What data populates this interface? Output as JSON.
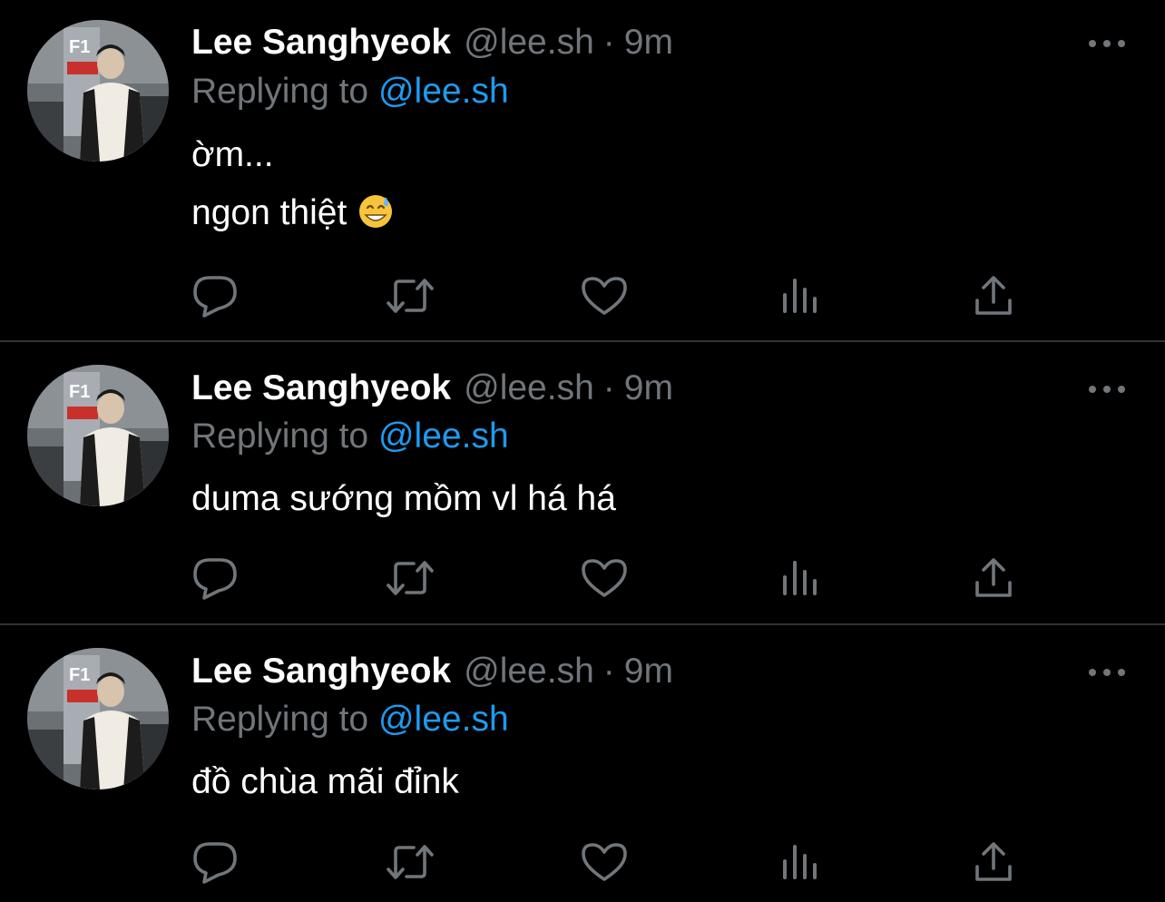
{
  "tweets": [
    {
      "author": {
        "name": "Lee Sanghyeok",
        "handle": "@lee.sh",
        "avatar_icon": "profile-photo"
      },
      "separator": "·",
      "time": "9m",
      "replying_prefix": "Replying to",
      "replying_to": "@lee.sh",
      "lines": [
        "ờm...",
        "ngon thiệt"
      ],
      "emoji": "grinning-face-with-sweat"
    },
    {
      "author": {
        "name": "Lee Sanghyeok",
        "handle": "@lee.sh",
        "avatar_icon": "profile-photo"
      },
      "separator": "·",
      "time": "9m",
      "replying_prefix": "Replying to",
      "replying_to": "@lee.sh",
      "lines": [
        "duma sướng mồm vl há há"
      ]
    },
    {
      "author": {
        "name": "Lee Sanghyeok",
        "handle": "@lee.sh",
        "avatar_icon": "profile-photo"
      },
      "separator": "·",
      "time": "9m",
      "replying_prefix": "Replying to",
      "replying_to": "@lee.sh",
      "lines": [
        "đồ chùa mãi đỉnk"
      ]
    }
  ],
  "actions": {
    "icons": [
      "reply-icon",
      "retweet-icon",
      "like-icon",
      "views-icon",
      "share-icon"
    ],
    "icon_color": "#71767b"
  },
  "colors": {
    "background": "#000000",
    "text": "#ffffff",
    "muted": "#71767b",
    "accent": "#1d9bf0",
    "divider": "#2f3336"
  }
}
